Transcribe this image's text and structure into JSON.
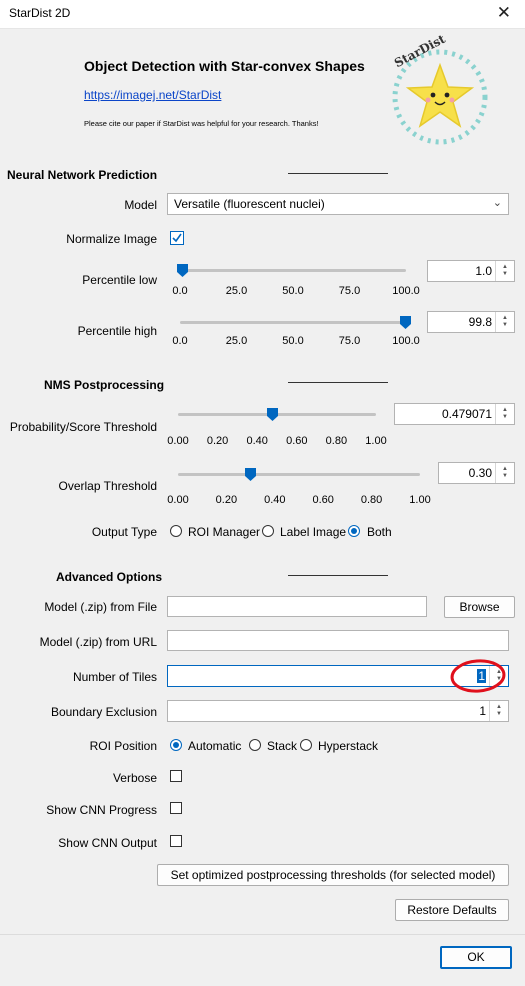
{
  "window": {
    "title": "StarDist 2D",
    "close_icon": "close-icon"
  },
  "header": {
    "title": "Object Detection with Star-convex Shapes",
    "link": "https://imagej.net/StarDist",
    "cite": "Please cite our paper if StarDist was helpful for your research. Thanks!",
    "logo_text": "StarDist"
  },
  "nn": {
    "heading": "Neural Network Prediction",
    "model_label": "Model",
    "model_value": "Versatile (fluorescent nuclei)",
    "normalize_label": "Normalize Image",
    "normalize_checked": true,
    "pct_low_label": "Percentile low",
    "pct_low_value": "1.0",
    "pct_low_level": 0.01,
    "pct_high_label": "Percentile high",
    "pct_high_value": "99.8",
    "pct_high_level": 0.998,
    "pct_ticks": [
      "0.0",
      "25.0",
      "50.0",
      "75.0",
      "100.0"
    ]
  },
  "nms": {
    "heading": "NMS Postprocessing",
    "prob_label": "Probability/Score Threshold",
    "prob_value": "0.479071",
    "prob_level": 0.479071,
    "prob_ticks": [
      "0.00",
      "0.20",
      "0.40",
      "0.60",
      "0.80",
      "1.00"
    ],
    "overlap_label": "Overlap Threshold",
    "overlap_value": "0.30",
    "overlap_level": 0.3,
    "overlap_ticks": [
      "0.00",
      "0.20",
      "0.40",
      "0.60",
      "0.80",
      "1.00"
    ],
    "output_label": "Output Type",
    "output_options": [
      "ROI Manager",
      "Label Image",
      "Both"
    ],
    "output_selected": "Both"
  },
  "adv": {
    "heading": "Advanced Options",
    "file_label": "Model (.zip) from File",
    "file_value": "",
    "browse_label": "Browse",
    "url_label": "Model (.zip) from URL",
    "url_value": "",
    "tiles_label": "Number of Tiles",
    "tiles_value": "1",
    "boundary_label": "Boundary Exclusion",
    "boundary_value": "1",
    "roi_label": "ROI Position",
    "roi_options": [
      "Automatic",
      "Stack",
      "Hyperstack"
    ],
    "roi_selected": "Automatic",
    "verbose_label": "Verbose",
    "progress_label": "Show CNN Progress",
    "output_label": "Show CNN Output",
    "optimize_button": "Set optimized postprocessing thresholds (for selected model)",
    "restore_button": "Restore Defaults"
  },
  "footer": {
    "ok_label": "OK"
  },
  "colors": {
    "accent": "#0067c0",
    "annotation": "#e0101c",
    "star": "#f7e04a"
  }
}
